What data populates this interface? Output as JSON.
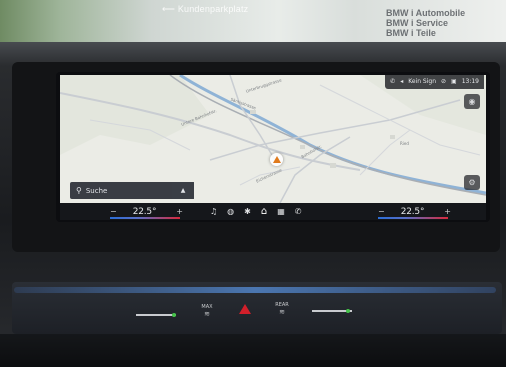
{
  "background": {
    "shop_sign": "Kundenparkplatz",
    "bmw_lines": [
      "BMW  i Automobile",
      "BMW  i Service",
      "BMW  i Teile"
    ]
  },
  "status_bar": {
    "signal": "Kein Sign",
    "time": "13:19"
  },
  "map": {
    "street_labels": [
      "Unterbruggstrasse",
      "Untere Bahnhofstr.",
      "Säntisstrasse",
      "Bahnhofstr.",
      "Eichenstrasse",
      "Ried"
    ],
    "search_label": "Suche"
  },
  "climate": {
    "left_temp": "22.5°",
    "right_temp": "22.5°",
    "minus": "−",
    "plus": "+"
  },
  "console": {
    "max_label": "MAX",
    "rear_label": "REAR"
  },
  "icons": {
    "music": "music-icon",
    "fan": "fan-icon",
    "home": "home-icon",
    "apps": "apps-icon",
    "phone": "phone-icon"
  }
}
